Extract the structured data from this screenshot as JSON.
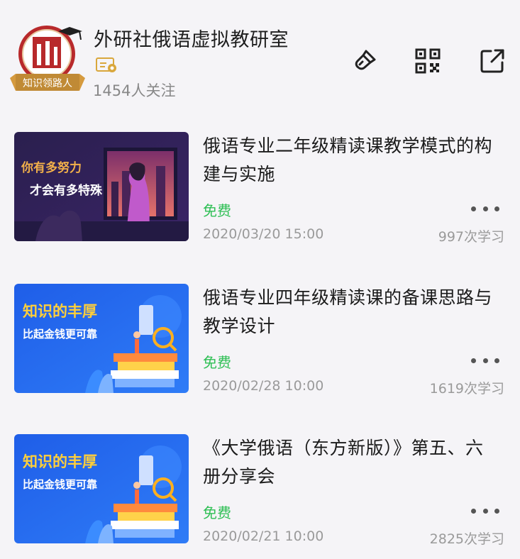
{
  "header": {
    "title": "外研社俄语虚拟教研室",
    "badge_label": "知识领路人",
    "followers": "1454人关注",
    "icons": [
      "brush-icon",
      "qr-code-icon",
      "share-icon"
    ]
  },
  "courses": [
    {
      "title": "俄语专业二年级精读课教学模式的构建与实施",
      "price": "免费",
      "date": "2020/03/20 15:00",
      "count": "997次学习",
      "thumb_line1": "你有多努力",
      "thumb_line2": "才会有多特殊"
    },
    {
      "title": "俄语专业四年级精读课的备课思路与教学设计",
      "price": "免费",
      "date": "2020/02/28 10:00",
      "count": "1619次学习",
      "thumb_line1": "知识的丰厚",
      "thumb_line2": "比起金钱更可靠"
    },
    {
      "title": "《大学俄语（东方新版）》第五、六册分享会",
      "price": "免费",
      "date": "2020/02/21 10:00",
      "count": "2825次学习",
      "thumb_line1": "知识的丰厚",
      "thumb_line2": "比起金钱更可靠"
    }
  ],
  "colors": {
    "free": "#2fbf55",
    "muted": "#9a9a9a",
    "background": "#f5f4f7",
    "badge": "#c0392b"
  }
}
